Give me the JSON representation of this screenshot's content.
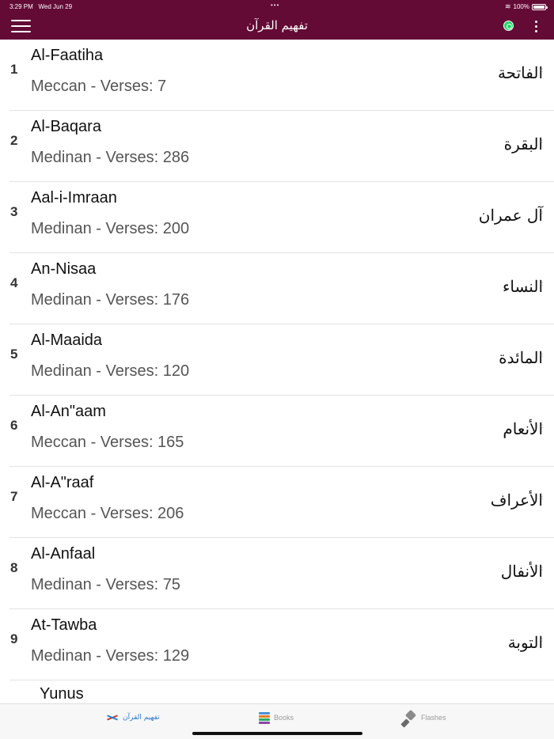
{
  "status_bar": {
    "time": "3:29 PM",
    "date": "Wed Jun 29",
    "dots": "•••",
    "wifi_icon": "wifi-icon",
    "battery": "100%"
  },
  "header": {
    "title": "تفهيم القرآن",
    "menu_icon": "hamburger-icon",
    "whatsapp_icon": "whatsapp-icon",
    "more_icon": "kebab-icon",
    "background": "#630a35"
  },
  "surahs": [
    {
      "number": "1",
      "name": "Al-Faatiha",
      "info": "Meccan - Verses: 7",
      "arabic": "الفاتحة"
    },
    {
      "number": "2",
      "name": "Al-Baqara",
      "info": "Medinan - Verses: 286",
      "arabic": "البقرة"
    },
    {
      "number": "3",
      "name": "Aal-i-Imraan",
      "info": "Medinan - Verses: 200",
      "arabic": "آل عمران"
    },
    {
      "number": "4",
      "name": "An-Nisaa",
      "info": "Medinan - Verses: 176",
      "arabic": "النساء"
    },
    {
      "number": "5",
      "name": "Al-Maaida",
      "info": "Medinan - Verses: 120",
      "arabic": "المائدة"
    },
    {
      "number": "6",
      "name": "Al-An\"aam",
      "info": "Meccan - Verses: 165",
      "arabic": "الأنعام"
    },
    {
      "number": "7",
      "name": "Al-A\"raaf",
      "info": "Meccan - Verses: 206",
      "arabic": "الأعراف"
    },
    {
      "number": "8",
      "name": "Al-Anfaal",
      "info": "Medinan - Verses: 75",
      "arabic": "الأنفال"
    },
    {
      "number": "9",
      "name": "At-Tawba",
      "info": "Medinan - Verses: 129",
      "arabic": "التوبة"
    }
  ],
  "partial_surah": {
    "name": "Yunus"
  },
  "tabs": [
    {
      "label": "تفهيم القرآن",
      "icon": "quran-icon",
      "active": true
    },
    {
      "label": "Books",
      "icon": "books-icon",
      "active": false
    },
    {
      "label": "Flashes",
      "icon": "flashlight-icon",
      "active": false
    }
  ]
}
